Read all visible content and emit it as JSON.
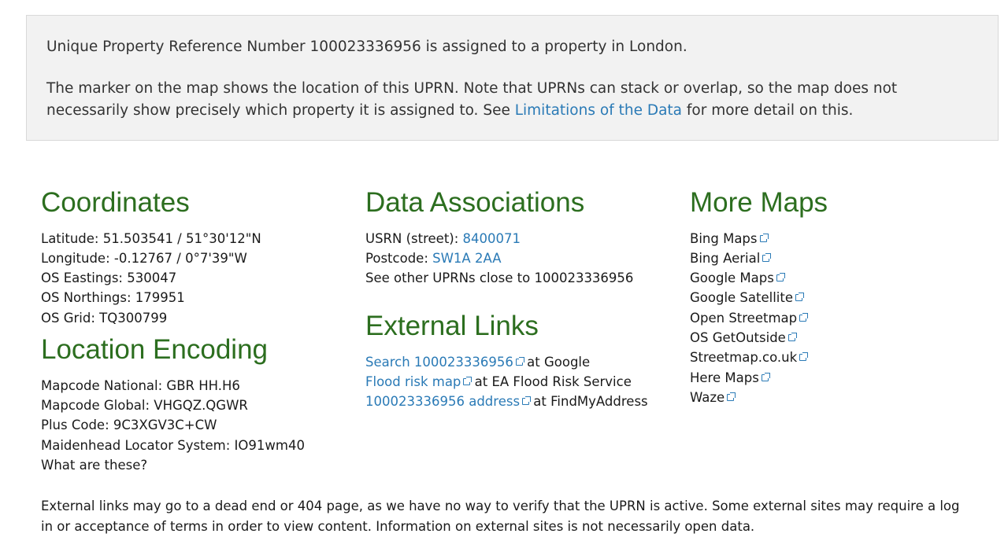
{
  "intro": {
    "line1": "Unique Property Reference Number 100023336956 is assigned to a property in London.",
    "line2_before": "The marker on the map shows the location of this UPRN. Note that UPRNs can stack or overlap, so the map does not necessarily show precisely which property it is assigned to. See ",
    "line2_link": "Limitations of the Data",
    "line2_after": " for more detail on this."
  },
  "coordinates": {
    "heading": "Coordinates",
    "latitude": "Latitude: 51.503541 / 51°30'12\"N",
    "longitude": "Longitude: -0.12767 / 0°7'39\"W",
    "eastings": "OS Eastings: 530047",
    "northings": "OS Northings: 179951",
    "grid": "OS Grid: TQ300799"
  },
  "location_encoding": {
    "heading": "Location Encoding",
    "mapcode_national": "Mapcode National: GBR HH.H6",
    "mapcode_global": "Mapcode Global: VHGQZ.QGWR",
    "plus_code": "Plus Code: 9C3XGV3C+CW",
    "maidenhead": "Maidenhead Locator System: IO91wm40",
    "what_link": "What are these?"
  },
  "data_associations": {
    "heading": "Data Associations",
    "usrn_label": "USRN (street): ",
    "usrn_value": "8400071",
    "postcode_label": "Postcode: ",
    "postcode_value": "SW1A 2AA",
    "nearby_link": "See other UPRNs close to 100023336956"
  },
  "external_links": {
    "heading": "External Links",
    "items": [
      {
        "link": "Search 100023336956",
        "suffix": " at Google"
      },
      {
        "link": "Flood risk map",
        "suffix": " at EA Flood Risk Service"
      },
      {
        "link": "100023336956 address",
        "suffix": " at FindMyAddress"
      }
    ]
  },
  "more_maps": {
    "heading": "More Maps",
    "items": [
      "Bing Maps",
      "Bing Aerial",
      "Google Maps",
      "Google Satellite",
      "Open Streetmap",
      "OS GetOutside",
      "Streetmap.co.uk",
      "Here Maps",
      "Waze"
    ]
  },
  "footer": "External links may go to a dead end or 404 page, as we have no way to verify that the UPRN is active. Some external sites may require a log in or acceptance of terms in order to view content. Information on external sites is not necessarily open data.",
  "colors": {
    "heading": "#2c6e1f",
    "link": "#2a7ab6",
    "box_bg": "#f2f2f2"
  },
  "icons": {
    "external_link": "external-link-icon"
  }
}
